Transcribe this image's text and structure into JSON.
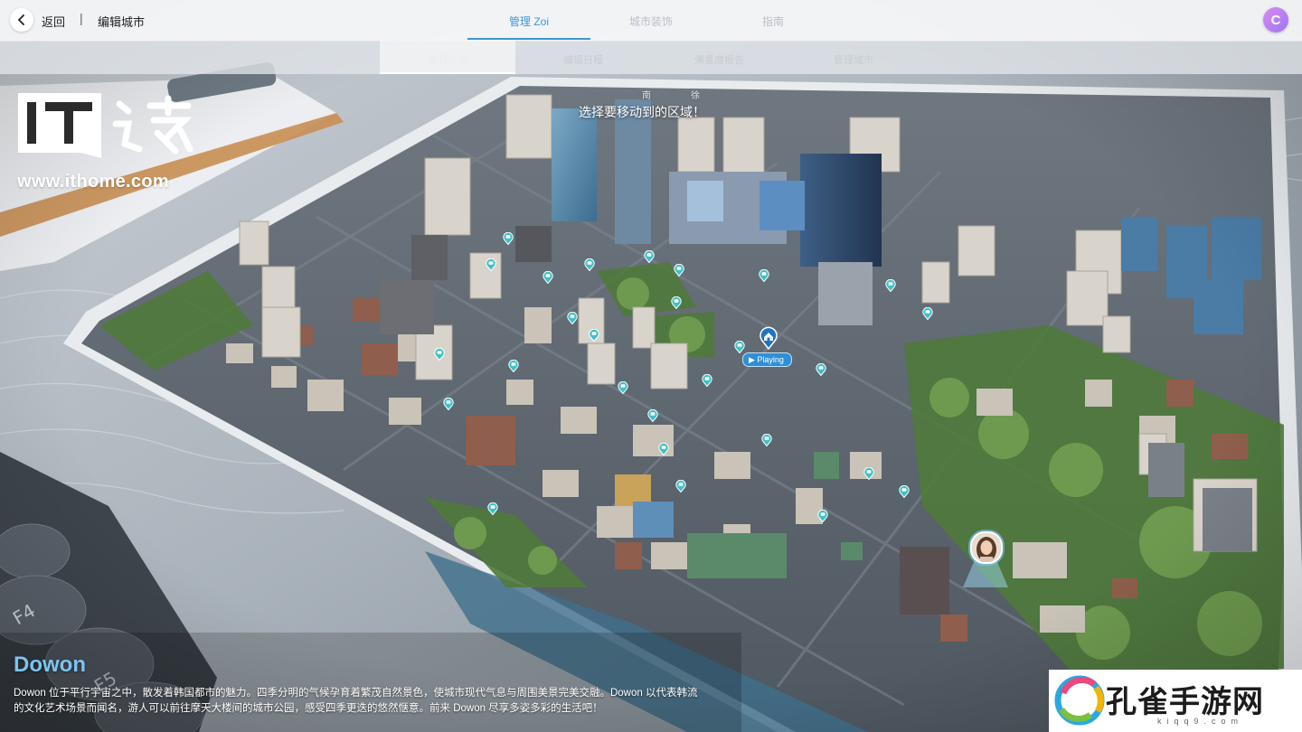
{
  "topbar": {
    "back_label": "返回",
    "separator": "|",
    "title": "编辑城市",
    "tabs": [
      {
        "label": "管理 Zoi",
        "active": true
      },
      {
        "label": "城市装饰",
        "active": false
      },
      {
        "label": "指南",
        "active": false
      }
    ],
    "profile_initial": "C"
  },
  "subbar": {
    "tabs": [
      {
        "label": "选择区域",
        "active": true
      },
      {
        "label": "编辑日程",
        "active": false
      },
      {
        "label": "满意度报告",
        "active": false
      },
      {
        "label": "管理城市",
        "active": false
      }
    ]
  },
  "watermark": {
    "logo_text": "IT之家",
    "url": "www.ithome.com"
  },
  "map": {
    "prompt": "选择要移动到的区域！",
    "small_labels": [
      "南",
      "徐"
    ],
    "playing_badge": "▶ Playing"
  },
  "city": {
    "name": "Dowon",
    "description": "Dowon 位于平行宇宙之中，散发着韩国都市的魅力。四季分明的气候孕育着繁茂自然景色，使城市现代气息与周围美景完美交融。Dowon 以代表韩流的文化艺术场景而闻名，游人可以前往摩天大楼间的城市公园，感受四季更迭的悠然惬意。前来 Dowon 尽享多姿多彩的生活吧！"
  },
  "watermark2": {
    "text": "孔雀手游网",
    "url": "kiqq9.com"
  },
  "colors": {
    "accent": "#3a97d8",
    "city_name": "#7cc4ee"
  }
}
